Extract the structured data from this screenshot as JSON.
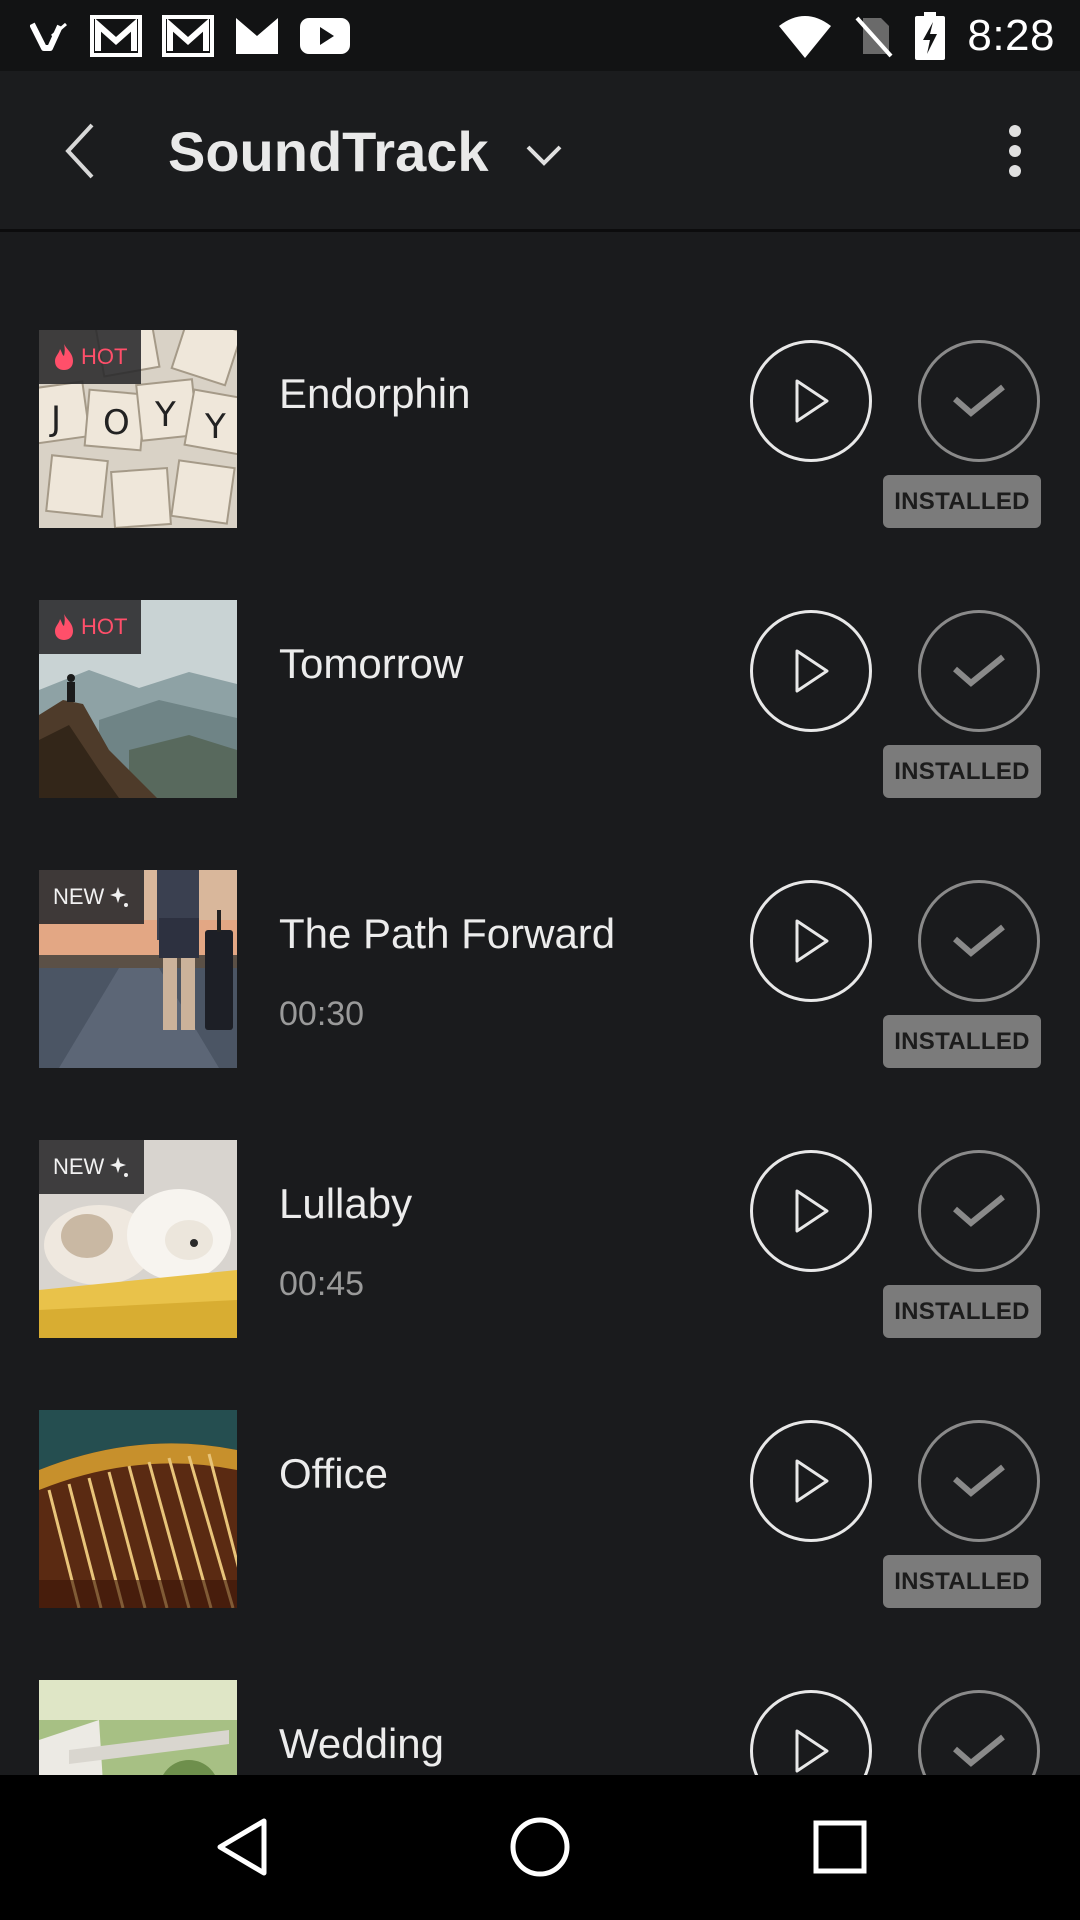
{
  "status_bar": {
    "time": "8:28",
    "left_icons": [
      "v-app-icon",
      "gmail-icon",
      "gmail-icon",
      "gmail-icon",
      "youtube-icon"
    ],
    "right_icons": [
      "wifi-icon",
      "no-sim-icon",
      "battery-charging-icon"
    ]
  },
  "app_bar": {
    "title": "SoundTrack"
  },
  "tracks": [
    {
      "name": "Endorphin",
      "badge": "HOT",
      "badge_type": "hot",
      "duration": "",
      "status": "INSTALLED",
      "thumb": "joy-blocks"
    },
    {
      "name": "Tomorrow",
      "badge": "HOT",
      "badge_type": "hot",
      "duration": "",
      "status": "INSTALLED",
      "thumb": "mountain-hiker"
    },
    {
      "name": "The Path Forward",
      "badge": "NEW",
      "badge_type": "new",
      "duration": "00:30",
      "status": "INSTALLED",
      "thumb": "road-traveler"
    },
    {
      "name": "Lullaby",
      "badge": "NEW",
      "badge_type": "new",
      "duration": "00:45",
      "status": "INSTALLED",
      "thumb": "sleeping-puppies"
    },
    {
      "name": "Office",
      "badge": "",
      "badge_type": "",
      "duration": "",
      "status": "INSTALLED",
      "thumb": "harp-strings"
    },
    {
      "name": "Wedding",
      "badge": "",
      "badge_type": "",
      "duration": "",
      "status": "",
      "thumb": "garden-bench"
    }
  ],
  "nav_bar": {
    "icons": [
      "back-triangle-icon",
      "home-circle-icon",
      "recents-square-icon"
    ]
  },
  "colors": {
    "background": "#1a1b1d",
    "hot_badge": "#ff4f6a",
    "installed_badge": "#7b7b7b"
  }
}
